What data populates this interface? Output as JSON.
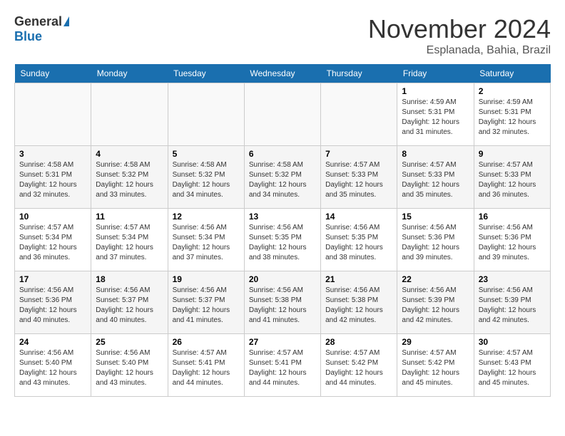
{
  "header": {
    "logo_general": "General",
    "logo_blue": "Blue",
    "month": "November 2024",
    "location": "Esplanada, Bahia, Brazil"
  },
  "days_of_week": [
    "Sunday",
    "Monday",
    "Tuesday",
    "Wednesday",
    "Thursday",
    "Friday",
    "Saturday"
  ],
  "weeks": [
    [
      {
        "day": "",
        "info": ""
      },
      {
        "day": "",
        "info": ""
      },
      {
        "day": "",
        "info": ""
      },
      {
        "day": "",
        "info": ""
      },
      {
        "day": "",
        "info": ""
      },
      {
        "day": "1",
        "info": "Sunrise: 4:59 AM\nSunset: 5:31 PM\nDaylight: 12 hours and 31 minutes."
      },
      {
        "day": "2",
        "info": "Sunrise: 4:59 AM\nSunset: 5:31 PM\nDaylight: 12 hours and 32 minutes."
      }
    ],
    [
      {
        "day": "3",
        "info": "Sunrise: 4:58 AM\nSunset: 5:31 PM\nDaylight: 12 hours and 32 minutes."
      },
      {
        "day": "4",
        "info": "Sunrise: 4:58 AM\nSunset: 5:32 PM\nDaylight: 12 hours and 33 minutes."
      },
      {
        "day": "5",
        "info": "Sunrise: 4:58 AM\nSunset: 5:32 PM\nDaylight: 12 hours and 34 minutes."
      },
      {
        "day": "6",
        "info": "Sunrise: 4:58 AM\nSunset: 5:32 PM\nDaylight: 12 hours and 34 minutes."
      },
      {
        "day": "7",
        "info": "Sunrise: 4:57 AM\nSunset: 5:33 PM\nDaylight: 12 hours and 35 minutes."
      },
      {
        "day": "8",
        "info": "Sunrise: 4:57 AM\nSunset: 5:33 PM\nDaylight: 12 hours and 35 minutes."
      },
      {
        "day": "9",
        "info": "Sunrise: 4:57 AM\nSunset: 5:33 PM\nDaylight: 12 hours and 36 minutes."
      }
    ],
    [
      {
        "day": "10",
        "info": "Sunrise: 4:57 AM\nSunset: 5:34 PM\nDaylight: 12 hours and 36 minutes."
      },
      {
        "day": "11",
        "info": "Sunrise: 4:57 AM\nSunset: 5:34 PM\nDaylight: 12 hours and 37 minutes."
      },
      {
        "day": "12",
        "info": "Sunrise: 4:56 AM\nSunset: 5:34 PM\nDaylight: 12 hours and 37 minutes."
      },
      {
        "day": "13",
        "info": "Sunrise: 4:56 AM\nSunset: 5:35 PM\nDaylight: 12 hours and 38 minutes."
      },
      {
        "day": "14",
        "info": "Sunrise: 4:56 AM\nSunset: 5:35 PM\nDaylight: 12 hours and 38 minutes."
      },
      {
        "day": "15",
        "info": "Sunrise: 4:56 AM\nSunset: 5:36 PM\nDaylight: 12 hours and 39 minutes."
      },
      {
        "day": "16",
        "info": "Sunrise: 4:56 AM\nSunset: 5:36 PM\nDaylight: 12 hours and 39 minutes."
      }
    ],
    [
      {
        "day": "17",
        "info": "Sunrise: 4:56 AM\nSunset: 5:36 PM\nDaylight: 12 hours and 40 minutes."
      },
      {
        "day": "18",
        "info": "Sunrise: 4:56 AM\nSunset: 5:37 PM\nDaylight: 12 hours and 40 minutes."
      },
      {
        "day": "19",
        "info": "Sunrise: 4:56 AM\nSunset: 5:37 PM\nDaylight: 12 hours and 41 minutes."
      },
      {
        "day": "20",
        "info": "Sunrise: 4:56 AM\nSunset: 5:38 PM\nDaylight: 12 hours and 41 minutes."
      },
      {
        "day": "21",
        "info": "Sunrise: 4:56 AM\nSunset: 5:38 PM\nDaylight: 12 hours and 42 minutes."
      },
      {
        "day": "22",
        "info": "Sunrise: 4:56 AM\nSunset: 5:39 PM\nDaylight: 12 hours and 42 minutes."
      },
      {
        "day": "23",
        "info": "Sunrise: 4:56 AM\nSunset: 5:39 PM\nDaylight: 12 hours and 42 minutes."
      }
    ],
    [
      {
        "day": "24",
        "info": "Sunrise: 4:56 AM\nSunset: 5:40 PM\nDaylight: 12 hours and 43 minutes."
      },
      {
        "day": "25",
        "info": "Sunrise: 4:56 AM\nSunset: 5:40 PM\nDaylight: 12 hours and 43 minutes."
      },
      {
        "day": "26",
        "info": "Sunrise: 4:57 AM\nSunset: 5:41 PM\nDaylight: 12 hours and 44 minutes."
      },
      {
        "day": "27",
        "info": "Sunrise: 4:57 AM\nSunset: 5:41 PM\nDaylight: 12 hours and 44 minutes."
      },
      {
        "day": "28",
        "info": "Sunrise: 4:57 AM\nSunset: 5:42 PM\nDaylight: 12 hours and 44 minutes."
      },
      {
        "day": "29",
        "info": "Sunrise: 4:57 AM\nSunset: 5:42 PM\nDaylight: 12 hours and 45 minutes."
      },
      {
        "day": "30",
        "info": "Sunrise: 4:57 AM\nSunset: 5:43 PM\nDaylight: 12 hours and 45 minutes."
      }
    ]
  ]
}
